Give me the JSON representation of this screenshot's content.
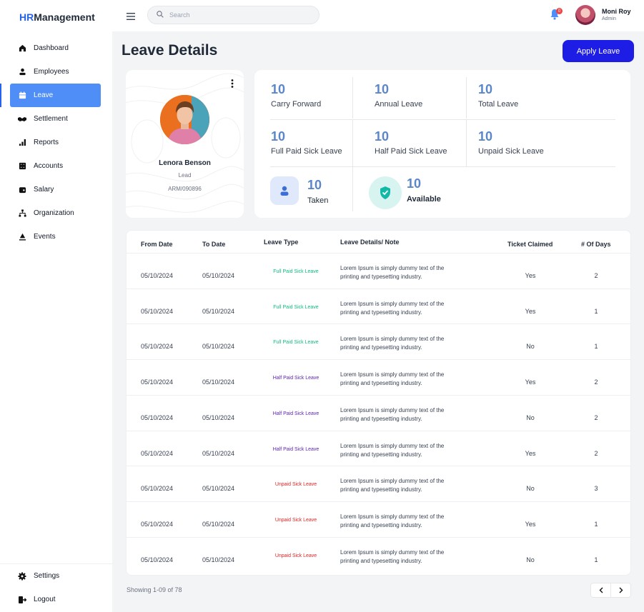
{
  "app": {
    "logo_prefix": "HR",
    "logo_suffix": "Management"
  },
  "sidebar": {
    "items": [
      {
        "label": "Dashboard",
        "icon": "home-icon"
      },
      {
        "label": "Employees",
        "icon": "user-icon"
      },
      {
        "label": "Leave",
        "icon": "calendar-icon",
        "active": true
      },
      {
        "label": "Settlement",
        "icon": "handshake-icon"
      },
      {
        "label": "Reports",
        "icon": "bar-chart-icon"
      },
      {
        "label": "Accounts",
        "icon": "calculator-icon"
      },
      {
        "label": "Salary",
        "icon": "wallet-icon"
      },
      {
        "label": "Organization",
        "icon": "org-chart-icon"
      },
      {
        "label": "Events",
        "icon": "event-icon"
      }
    ],
    "bottom": [
      {
        "label": "Settings",
        "icon": "gear-icon"
      },
      {
        "label": "Logout",
        "icon": "logout-icon"
      }
    ]
  },
  "topbar": {
    "search_placeholder": "Search",
    "notification_count": "0",
    "user_name": "Moni Roy",
    "user_role": "Admin"
  },
  "page": {
    "title": "Leave Details",
    "apply_label": "Apply Leave"
  },
  "profile": {
    "name": "Lenora Benson",
    "role": "Lead",
    "id": "ARM/090896"
  },
  "stats": {
    "row1": [
      {
        "value": "10",
        "label": "Carry Forward"
      },
      {
        "value": "10",
        "label": "Annual Leave"
      },
      {
        "value": "10",
        "label": "Total Leave"
      }
    ],
    "row2": [
      {
        "value": "10",
        "label": "Full Paid Sick Leave"
      },
      {
        "value": "10",
        "label": "Half Paid Sick Leave"
      },
      {
        "value": "10",
        "label": "Unpaid Sick Leave"
      }
    ],
    "taken": {
      "value": "10",
      "label": "Taken"
    },
    "available": {
      "value": "10",
      "label": "Available"
    }
  },
  "table": {
    "headers": [
      "From Date",
      "To Date",
      "Leave Type",
      "Leave Details/ Note",
      "Ticket Claimed",
      "# Of Days"
    ],
    "rows": [
      {
        "from": "05/10/2024",
        "to": "05/10/2024",
        "type": "Full Paid Sick Leave",
        "note1": "Lorem Ipsum is simply dummy text of the",
        "note2": "printing and typesetting industry.",
        "ticket": "Yes",
        "days": "2"
      },
      {
        "from": "05/10/2024",
        "to": "05/10/2024",
        "type": "Full Paid Sick Leave",
        "note1": "Lorem Ipsum is simply dummy text of the",
        "note2": "printing and typesetting industry.",
        "ticket": "Yes",
        "days": "1"
      },
      {
        "from": "05/10/2024",
        "to": "05/10/2024",
        "type": "Full Paid Sick Leave",
        "note1": "Lorem Ipsum is simply dummy text of the",
        "note2": "printing and typesetting industry.",
        "ticket": "No",
        "days": "1"
      },
      {
        "from": "05/10/2024",
        "to": "05/10/2024",
        "type": "Half Paid Sick Leave",
        "note1": "Lorem Ipsum is simply dummy text of the",
        "note2": "printing and typesetting industry.",
        "ticket": "Yes",
        "days": "2"
      },
      {
        "from": "05/10/2024",
        "to": "05/10/2024",
        "type": "Half Paid Sick Leave",
        "note1": "Lorem Ipsum is simply dummy text of the",
        "note2": "printing and typesetting industry.",
        "ticket": "No",
        "days": "2"
      },
      {
        "from": "05/10/2024",
        "to": "05/10/2024",
        "type": "Half Paid Sick Leave",
        "note1": "Lorem Ipsum is simply dummy text of the",
        "note2": "printing and typesetting industry.",
        "ticket": "Yes",
        "days": "2"
      },
      {
        "from": "05/10/2024",
        "to": "05/10/2024",
        "type": "Unpaid Sick Leave",
        "note1": "Lorem Ipsum is simply dummy text of the",
        "note2": "printing and typesetting industry.",
        "ticket": "No",
        "days": "3"
      },
      {
        "from": "05/10/2024",
        "to": "05/10/2024",
        "type": "Unpaid Sick Leave",
        "note1": "Lorem Ipsum is simply dummy text of the",
        "note2": "printing and typesetting industry.",
        "ticket": "Yes",
        "days": "1"
      },
      {
        "from": "05/10/2024",
        "to": "05/10/2024",
        "type": "Unpaid Sick Leave",
        "note1": "Lorem Ipsum is simply dummy text of the",
        "note2": "printing and typesetting industry.",
        "ticket": "No",
        "days": "1"
      }
    ]
  },
  "leave_type_colors": {
    "Full Paid Sick Leave": "#10b981",
    "Half Paid Sick Leave": "#5b21b6",
    "Unpaid Sick Leave": "#dc2626"
  },
  "footer": {
    "showing": "Showing 1-09 of 78"
  },
  "colors": {
    "accent": "#1d1de6",
    "active_nav": "#4f8ef7",
    "stat_number": "#5b86c9"
  }
}
